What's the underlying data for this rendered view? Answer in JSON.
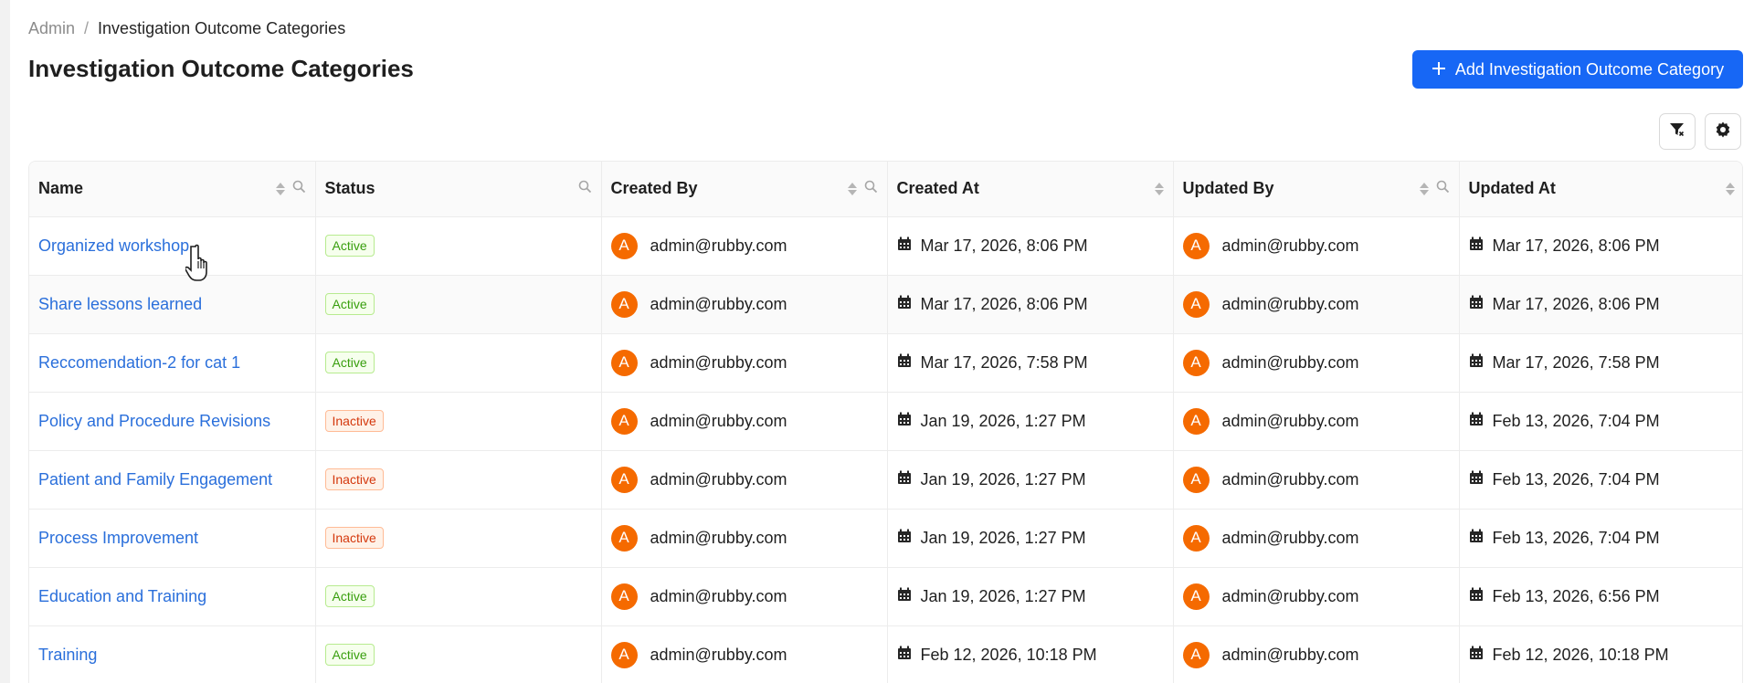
{
  "breadcrumb": {
    "root": "Admin",
    "separator": "/",
    "current": "Investigation Outcome Categories"
  },
  "page": {
    "title": "Investigation Outcome Categories"
  },
  "actions": {
    "add_label": "Add Investigation Outcome Category",
    "add_icon": "plus-icon",
    "filter_icon": "clear-filter-icon",
    "settings_icon": "gear-icon"
  },
  "colors": {
    "primary": "#1767f5",
    "link": "#2a6fdb",
    "active_tag": "#389e0d",
    "inactive_tag": "#d4380d",
    "avatar": "#f56a00"
  },
  "table": {
    "columns": [
      {
        "label": "Name",
        "sortable": true,
        "searchable": true
      },
      {
        "label": "Status",
        "sortable": false,
        "searchable": true
      },
      {
        "label": "Created By",
        "sortable": true,
        "searchable": true
      },
      {
        "label": "Created At",
        "sortable": true,
        "searchable": false
      },
      {
        "label": "Updated By",
        "sortable": true,
        "searchable": true
      },
      {
        "label": "Updated At",
        "sortable": true,
        "searchable": false
      }
    ],
    "rows": [
      {
        "name": "Organized workshop",
        "status": "Active",
        "created_by": "admin@rubby.com",
        "created_initial": "A",
        "created_at": "Mar 17, 2026, 8:06 PM",
        "updated_by": "admin@rubby.com",
        "updated_initial": "A",
        "updated_at": "Mar 17, 2026, 8:06 PM"
      },
      {
        "name": "Share lessons learned",
        "status": "Active",
        "created_by": "admin@rubby.com",
        "created_initial": "A",
        "created_at": "Mar 17, 2026, 8:06 PM",
        "updated_by": "admin@rubby.com",
        "updated_initial": "A",
        "updated_at": "Mar 17, 2026, 8:06 PM"
      },
      {
        "name": "Reccomendation-2 for cat 1",
        "status": "Active",
        "created_by": "admin@rubby.com",
        "created_initial": "A",
        "created_at": "Mar 17, 2026, 7:58 PM",
        "updated_by": "admin@rubby.com",
        "updated_initial": "A",
        "updated_at": "Mar 17, 2026, 7:58 PM"
      },
      {
        "name": "Policy and Procedure Revisions",
        "status": "Inactive",
        "created_by": "admin@rubby.com",
        "created_initial": "A",
        "created_at": "Jan 19, 2026, 1:27 PM",
        "updated_by": "admin@rubby.com",
        "updated_initial": "A",
        "updated_at": "Feb 13, 2026, 7:04 PM"
      },
      {
        "name": "Patient and Family Engagement",
        "status": "Inactive",
        "created_by": "admin@rubby.com",
        "created_initial": "A",
        "created_at": "Jan 19, 2026, 1:27 PM",
        "updated_by": "admin@rubby.com",
        "updated_initial": "A",
        "updated_at": "Feb 13, 2026, 7:04 PM"
      },
      {
        "name": "Process Improvement",
        "status": "Inactive",
        "created_by": "admin@rubby.com",
        "created_initial": "A",
        "created_at": "Jan 19, 2026, 1:27 PM",
        "updated_by": "admin@rubby.com",
        "updated_initial": "A",
        "updated_at": "Feb 13, 2026, 7:04 PM"
      },
      {
        "name": "Education and Training",
        "status": "Active",
        "created_by": "admin@rubby.com",
        "created_initial": "A",
        "created_at": "Jan 19, 2026, 1:27 PM",
        "updated_by": "admin@rubby.com",
        "updated_initial": "A",
        "updated_at": "Feb 13, 2026, 6:56 PM"
      },
      {
        "name": "Training",
        "status": "Active",
        "created_by": "admin@rubby.com",
        "created_initial": "A",
        "created_at": "Feb 12, 2026, 10:18 PM",
        "updated_by": "admin@rubby.com",
        "updated_initial": "A",
        "updated_at": "Feb 12, 2026, 10:18 PM"
      }
    ]
  }
}
